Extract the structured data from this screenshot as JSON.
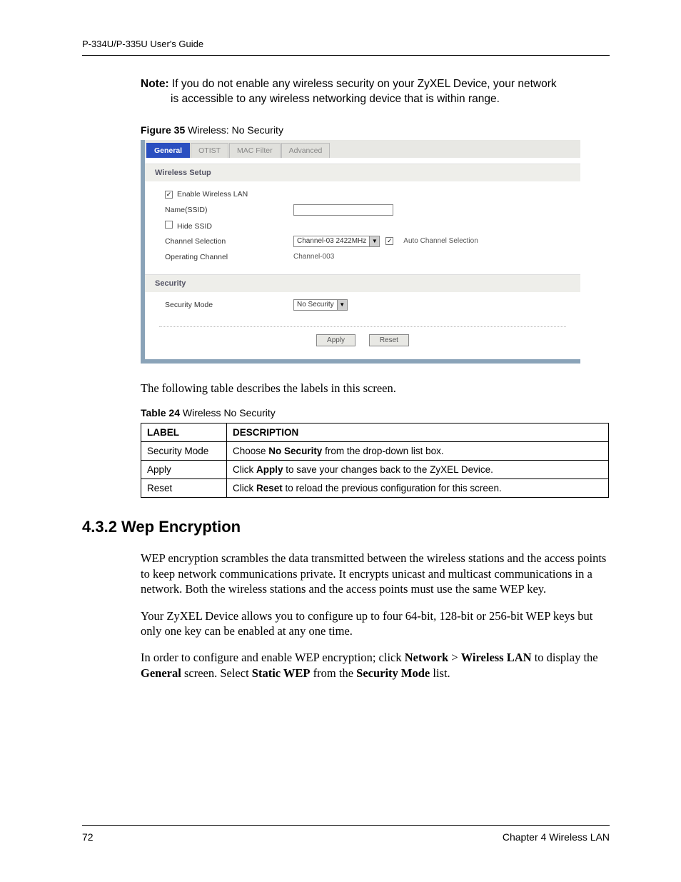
{
  "header": {
    "running": "P-334U/P-335U User's Guide"
  },
  "note": {
    "label": "Note:",
    "text1": " If you do not enable any wireless security on your ZyXEL Device, your network",
    "text2": "is accessible to any wireless networking device that is within range."
  },
  "figure": {
    "label": "Figure 35",
    "title": "   Wireless: No Security"
  },
  "screenshot": {
    "tabs": [
      "General",
      "OTIST",
      "MAC Filter",
      "Advanced"
    ],
    "section1": "Wireless Setup",
    "enable_wlan": "Enable Wireless LAN",
    "ssid_label": "Name(SSID)",
    "ssid_value": "",
    "hide_ssid": "Hide SSID",
    "chan_sel_label": "Channel Selection",
    "chan_sel_value": "Channel-03 2422MHz",
    "auto_chan": "Auto Channel Selection",
    "op_chan_label": "Operating Channel",
    "op_chan_value": "Channel-003",
    "section2": "Security",
    "sec_mode_label": "Security Mode",
    "sec_mode_value": "No Security",
    "apply": "Apply",
    "reset": "Reset"
  },
  "intro_table": "The following table describes the labels in this screen.",
  "table": {
    "caption_label": "Table 24",
    "caption_title": "   Wireless No Security",
    "headers": [
      "LABEL",
      "DESCRIPTION"
    ],
    "rows": [
      {
        "label": "Security Mode",
        "pre": "Choose ",
        "bold": "No Security",
        "post": " from the drop-down list box."
      },
      {
        "label": "Apply",
        "pre": "Click ",
        "bold": "Apply",
        "post": " to save your changes back to the ZyXEL Device."
      },
      {
        "label": "Reset",
        "pre": "Click ",
        "bold": "Reset",
        "post": " to reload the previous configuration for this screen."
      }
    ]
  },
  "section": {
    "heading": "4.3.2  Wep Encryption",
    "p1": "WEP encryption scrambles the data transmitted between the wireless stations and the access points to keep network communications private. It encrypts unicast and multicast communications in a network. Both the wireless stations and the access points must use the same WEP key.",
    "p2": "Your ZyXEL Device allows you to configure up to four 64-bit, 128-bit or 256-bit WEP keys but only one key can be enabled at any one time.",
    "p3_a": "In order to configure and enable WEP encryption; click ",
    "p3_b1": "Network",
    "p3_gt": " > ",
    "p3_b2": "Wireless LAN",
    "p3_c": " to display the ",
    "p3_b3": "General",
    "p3_d": " screen. Select ",
    "p3_b4": "Static WEP",
    "p3_e": " from the ",
    "p3_b5": "Security Mode",
    "p3_f": " list."
  },
  "footer": {
    "page": "72",
    "chapter": "Chapter 4 Wireless LAN"
  }
}
